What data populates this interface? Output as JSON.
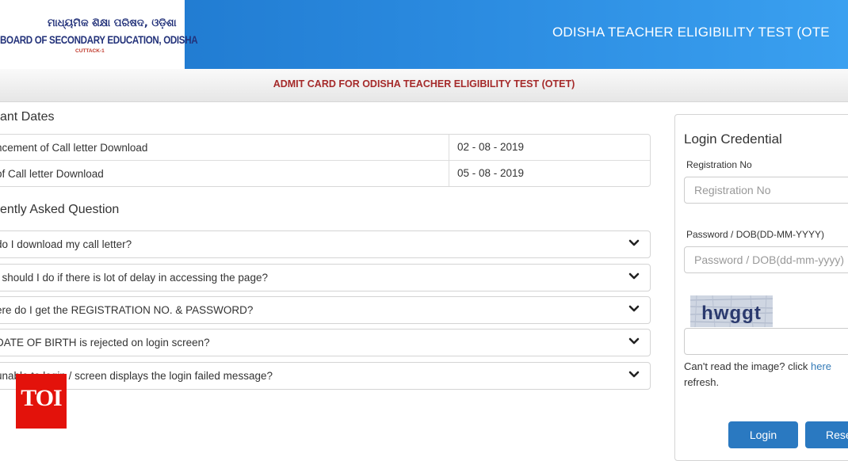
{
  "header": {
    "logo_odia": "ମାଧ୍ୟମିକ ଶିକ୍ଷା ପରିଷଦ, ଓଡ଼ିଶା",
    "logo_board": "BOARD OF SECONDARY EDUCATION, ODISHA",
    "logo_city": "CUTTACK-1",
    "title": "ODISHA TEACHER ELIGIBILITY TEST (OTE"
  },
  "subbar": {
    "title": "ADMIT CARD FOR ODISHA TEACHER ELIGIBILITY TEST (OTET)"
  },
  "dates": {
    "heading": "ant Dates",
    "rows": [
      {
        "label": "ncement of Call letter Download",
        "value": "02 - 08 - 2019"
      },
      {
        "label": "of Call letter Download",
        "value": "05 - 08 - 2019"
      }
    ]
  },
  "faq": {
    "heading": "ently Asked Question",
    "items": [
      {
        "question": "do I download my call letter?"
      },
      {
        "question": "t should I do if there is lot of delay in accessing the page?"
      },
      {
        "question": "ere do I get the REGISTRATION NO. & PASSWORD?"
      },
      {
        "question": "DATE OF BIRTH is rejected on login screen?"
      },
      {
        "question": "unable to login / screen displays the login failed message?"
      }
    ]
  },
  "badge": {
    "text": "TOI"
  },
  "login": {
    "title": "Login Credential",
    "registration_label": "Registration No",
    "registration_placeholder": "Registration No",
    "password_label": "Password / DOB(DD-MM-YYYY)",
    "password_placeholder": "Password / DOB(dd-mm-yyyy)",
    "captcha_text": "hwggt",
    "captcha_value": "",
    "captcha_help_prefix": "Can't read the image? click ",
    "captcha_help_link": "here",
    "captcha_help_suffix": "refresh.",
    "login_button": "Login",
    "reset_button": "Rese"
  },
  "colors": {
    "header_blue": "#2b8be0",
    "subbar_title": "#a52a2a",
    "button_blue": "#2a79c1",
    "badge_red": "#e3120b"
  }
}
